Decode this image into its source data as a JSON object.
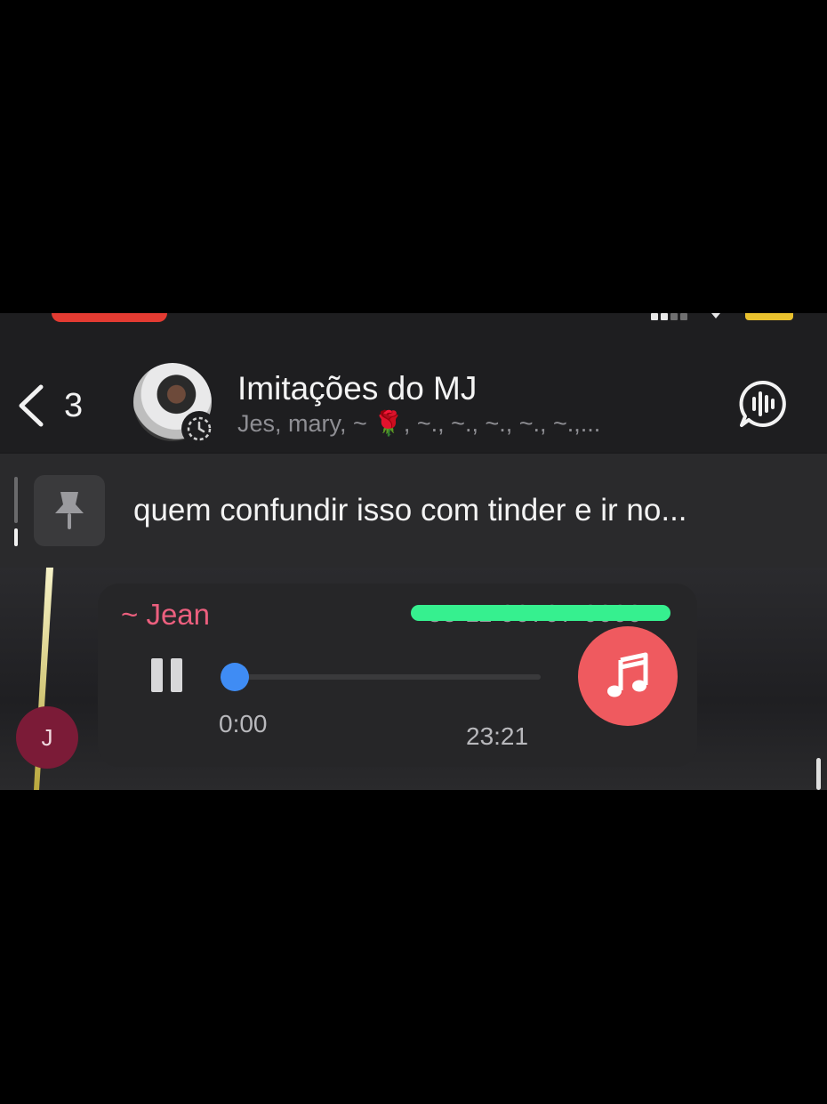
{
  "header": {
    "back_count": "3",
    "title": "Imitações do MJ",
    "members": "Jes, mary, ~ 🌹, ~., ~., ~., ~., ~.,..."
  },
  "pinned": {
    "text": "quem confundir isso com tinder e ir no..."
  },
  "message": {
    "sender": "~ Jean",
    "phone_redacted": "+55 11 90707-0000",
    "elapsed": "0:00",
    "duration": "23:21",
    "progress": 0.0,
    "avatar_initial": "J",
    "state": "playing"
  },
  "colors": {
    "sender": "#ec5f7e",
    "accent": "#3f8cf4",
    "music_button": "#ef5a5f",
    "redaction": "#36f08f",
    "avatar": "#7b1b37"
  },
  "icons": {
    "back": "chevron-left-icon",
    "timer": "auto-delete-timer-icon",
    "voice_chat": "voice-chat-icon",
    "pin": "pin-icon",
    "pause": "pause-icon",
    "music": "music-note-icon"
  }
}
